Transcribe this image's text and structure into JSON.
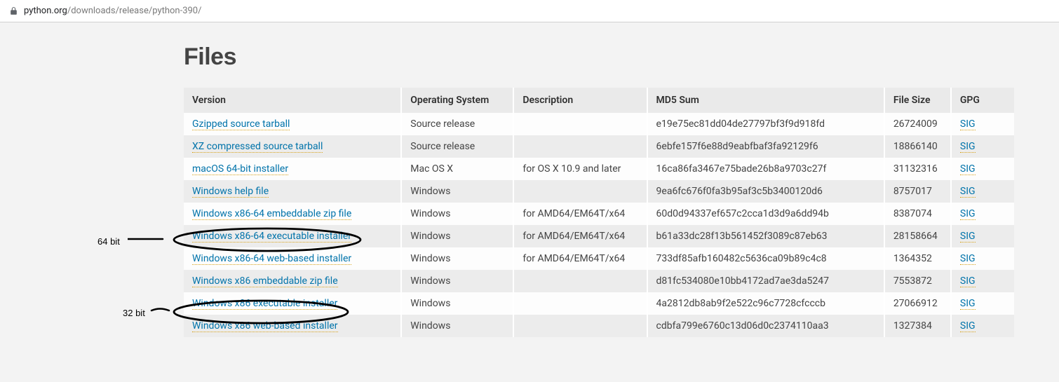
{
  "url": {
    "host": "python.org",
    "path": "/downloads/release/python-390/"
  },
  "heading": "Files",
  "columns": {
    "version": "Version",
    "os": "Operating System",
    "desc": "Description",
    "md5": "MD5 Sum",
    "size": "File Size",
    "gpg": "GPG"
  },
  "sig_label": "SIG",
  "rows": [
    {
      "version": "Gzipped source tarball",
      "os": "Source release",
      "desc": "",
      "md5": "e19e75ec81dd04de27797bf3f9d918fd",
      "size": "26724009"
    },
    {
      "version": "XZ compressed source tarball",
      "os": "Source release",
      "desc": "",
      "md5": "6ebfe157f6e88d9eabfbaf3fa92129f6",
      "size": "18866140"
    },
    {
      "version": "macOS 64-bit installer",
      "os": "Mac OS X",
      "desc": "for OS X 10.9 and later",
      "md5": "16ca86fa3467e75bade26b8a9703c27f",
      "size": "31132316"
    },
    {
      "version": "Windows help file",
      "os": "Windows",
      "desc": "",
      "md5": "9ea6fc676f0fa3b95af3c5b3400120d6",
      "size": "8757017"
    },
    {
      "version": "Windows x86-64 embeddable zip file",
      "os": "Windows",
      "desc": "for AMD64/EM64T/x64",
      "md5": "60d0d94337ef657c2cca1d3d9a6dd94b",
      "size": "8387074"
    },
    {
      "version": "Windows x86-64 executable installer",
      "os": "Windows",
      "desc": "for AMD64/EM64T/x64",
      "md5": "b61a33dc28f13b561452f3089c87eb63",
      "size": "28158664"
    },
    {
      "version": "Windows x86-64 web-based installer",
      "os": "Windows",
      "desc": "for AMD64/EM64T/x64",
      "md5": "733df85afb160482c5636ca09b89c4c8",
      "size": "1364352"
    },
    {
      "version": "Windows x86 embeddable zip file",
      "os": "Windows",
      "desc": "",
      "md5": "d81fc534080e10bb4172ad7ae3da5247",
      "size": "7553872"
    },
    {
      "version": "Windows x86 executable installer",
      "os": "Windows",
      "desc": "",
      "md5": "4a2812db8ab9f2e522c96c7728cfcccb",
      "size": "27066912"
    },
    {
      "version": "Windows x86 web-based installer",
      "os": "Windows",
      "desc": "",
      "md5": "cdbfa799e6760c13d06d0c2374110aa3",
      "size": "1327384"
    }
  ],
  "annotations": {
    "label64": "64 bit",
    "label32": "32 bit"
  }
}
